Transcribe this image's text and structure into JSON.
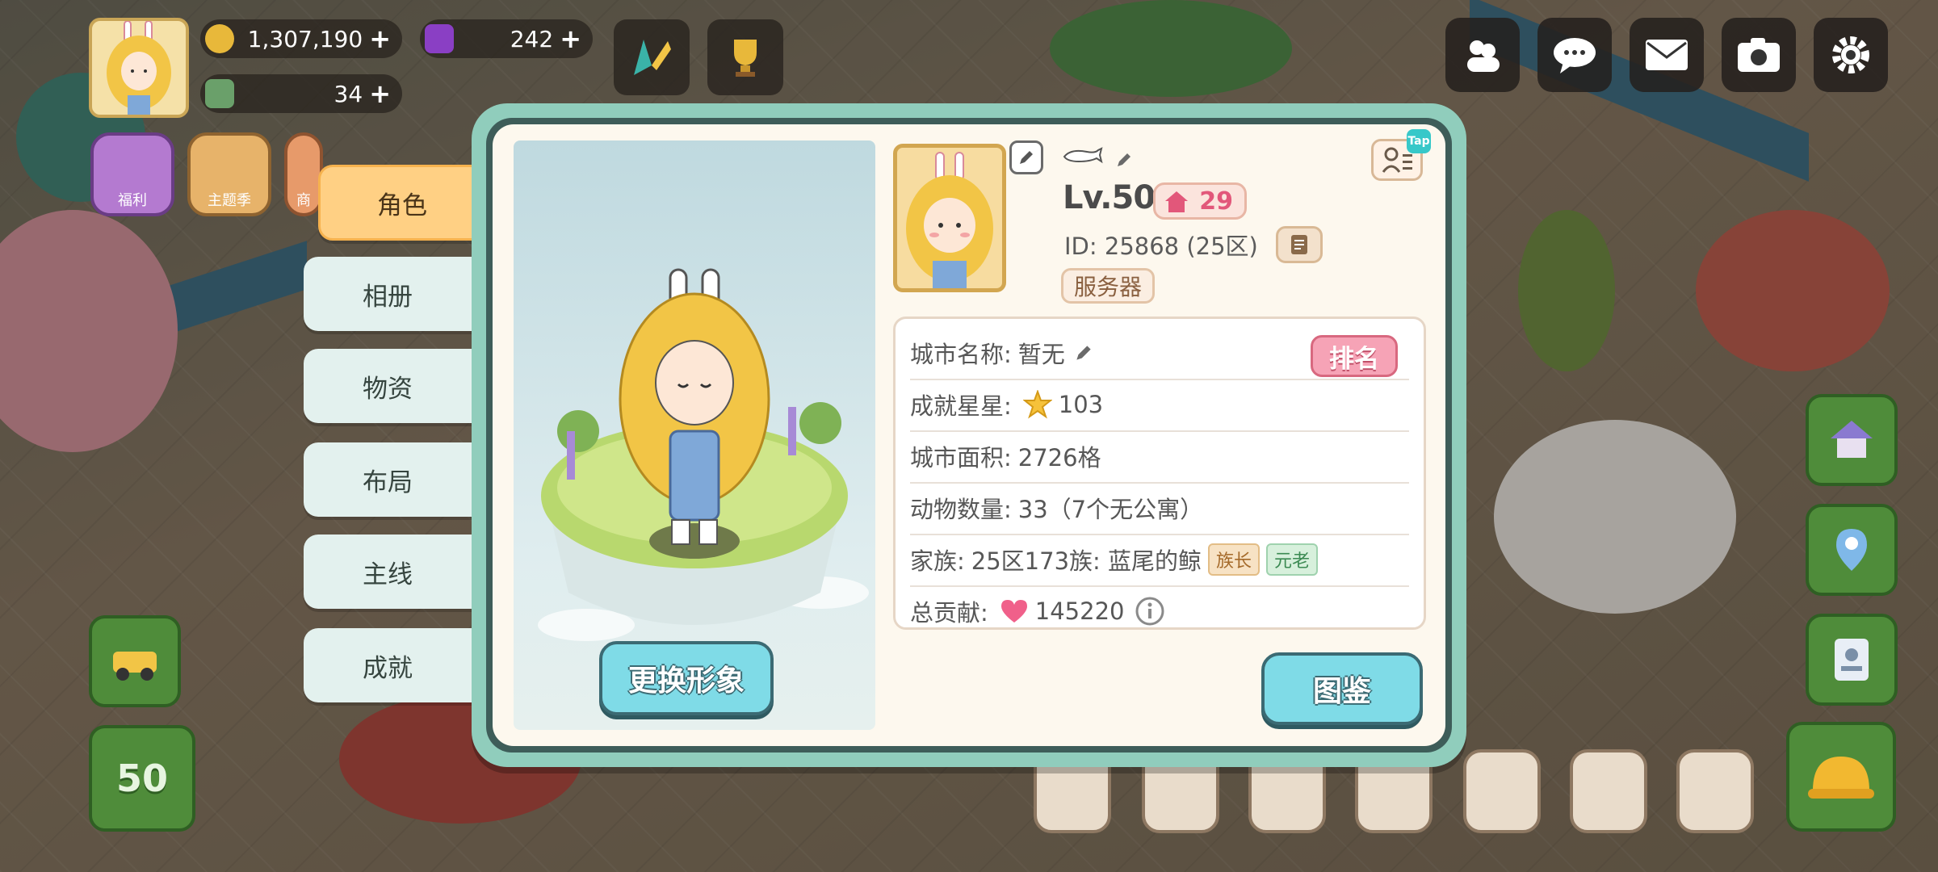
{
  "hud": {
    "coins": "1,307,190",
    "gems": "242",
    "energy": "34",
    "plus": "+",
    "level_badge": "50",
    "quick_icons": [
      "福利",
      "主题季",
      "商"
    ]
  },
  "tabs": [
    {
      "label": "角色",
      "active": true
    },
    {
      "label": "相册",
      "active": false
    },
    {
      "label": "物资",
      "active": false
    },
    {
      "label": "布局",
      "active": false
    },
    {
      "label": "主线",
      "active": false
    },
    {
      "label": "成就",
      "active": false
    }
  ],
  "character": {
    "change_button": "更换形象"
  },
  "profile": {
    "level": "Lv.50",
    "hearts": "29",
    "id_text": "ID: 25868 (25区)",
    "server_button": "服务器",
    "tap_tag": "Tap"
  },
  "info": {
    "city_name_label": "城市名称:",
    "city_name_value": "暂无",
    "rank_button": "排名",
    "stars_label": "成就星星:",
    "stars_value": "103",
    "area_label": "城市面积:",
    "area_value": "2726格",
    "animals_label": "动物数量:",
    "animals_value": "33（7个无公寓）",
    "clan_label": "家族:",
    "clan_value": "25区173族: 蓝尾的鲸",
    "clan_tag_leader": "族长",
    "clan_tag_elder": "元老",
    "contribution_label": "总贡献:",
    "contribution_value": "145220"
  },
  "gallery_button": "图鉴",
  "colors": {
    "dialog_frame": "#90cdbc",
    "active_tab": "#ffd084",
    "button_cyan": "#7fdbe7",
    "rank_pink": "#f6a3b6"
  }
}
